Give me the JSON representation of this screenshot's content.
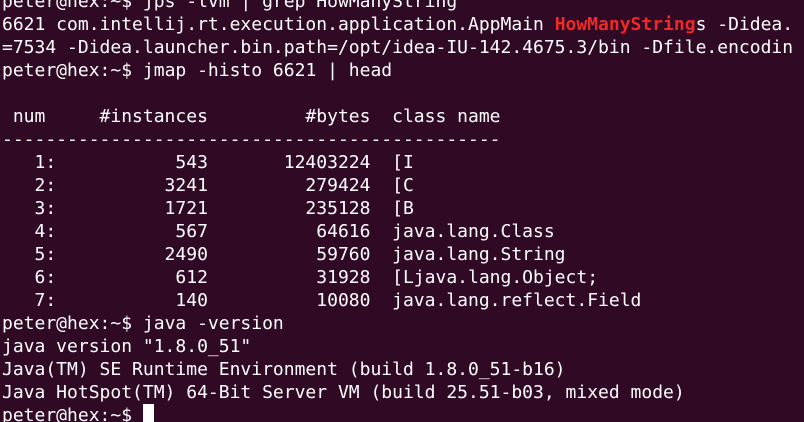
{
  "theme": {
    "background": "#300a24",
    "foreground": "#ffffff",
    "highlight": "#ef2929"
  },
  "prompt": "peter@hex:~$ ",
  "cmd1": {
    "command": "jps -lvm | grep HowManyString",
    "output_line1_before": "6621 com.intellij.rt.execution.application.AppMain ",
    "output_line1_match": "HowManyString",
    "output_line1_after": "s -Didea.",
    "output_line2": "=7534 -Didea.launcher.bin.path=/opt/idea-IU-142.4675.3/bin -Dfile.encodin"
  },
  "cmd2": {
    "command": "jmap -histo 6621 | head"
  },
  "histo": {
    "blank": "",
    "header": " num     #instances         #bytes  class name",
    "separator": "----------------------------------------------",
    "rows": [
      "   1:           543       12403224  [I",
      "   2:          3241         279424  [C",
      "   3:          1721         235128  [B",
      "   4:           567          64616  java.lang.Class",
      "   5:          2490          59760  java.lang.String",
      "   6:           612          31928  [Ljava.lang.Object;",
      "   7:           140          10080  java.lang.reflect.Field"
    ]
  },
  "cmd3": {
    "command": "java -version",
    "output": [
      "java version \"1.8.0_51\"",
      "Java(TM) SE Runtime Environment (build 1.8.0_51-b16)",
      "Java HotSpot(TM) 64-Bit Server VM (build 25.51-b03, mixed mode)"
    ]
  },
  "final_prompt": "peter@hex:~$ "
}
